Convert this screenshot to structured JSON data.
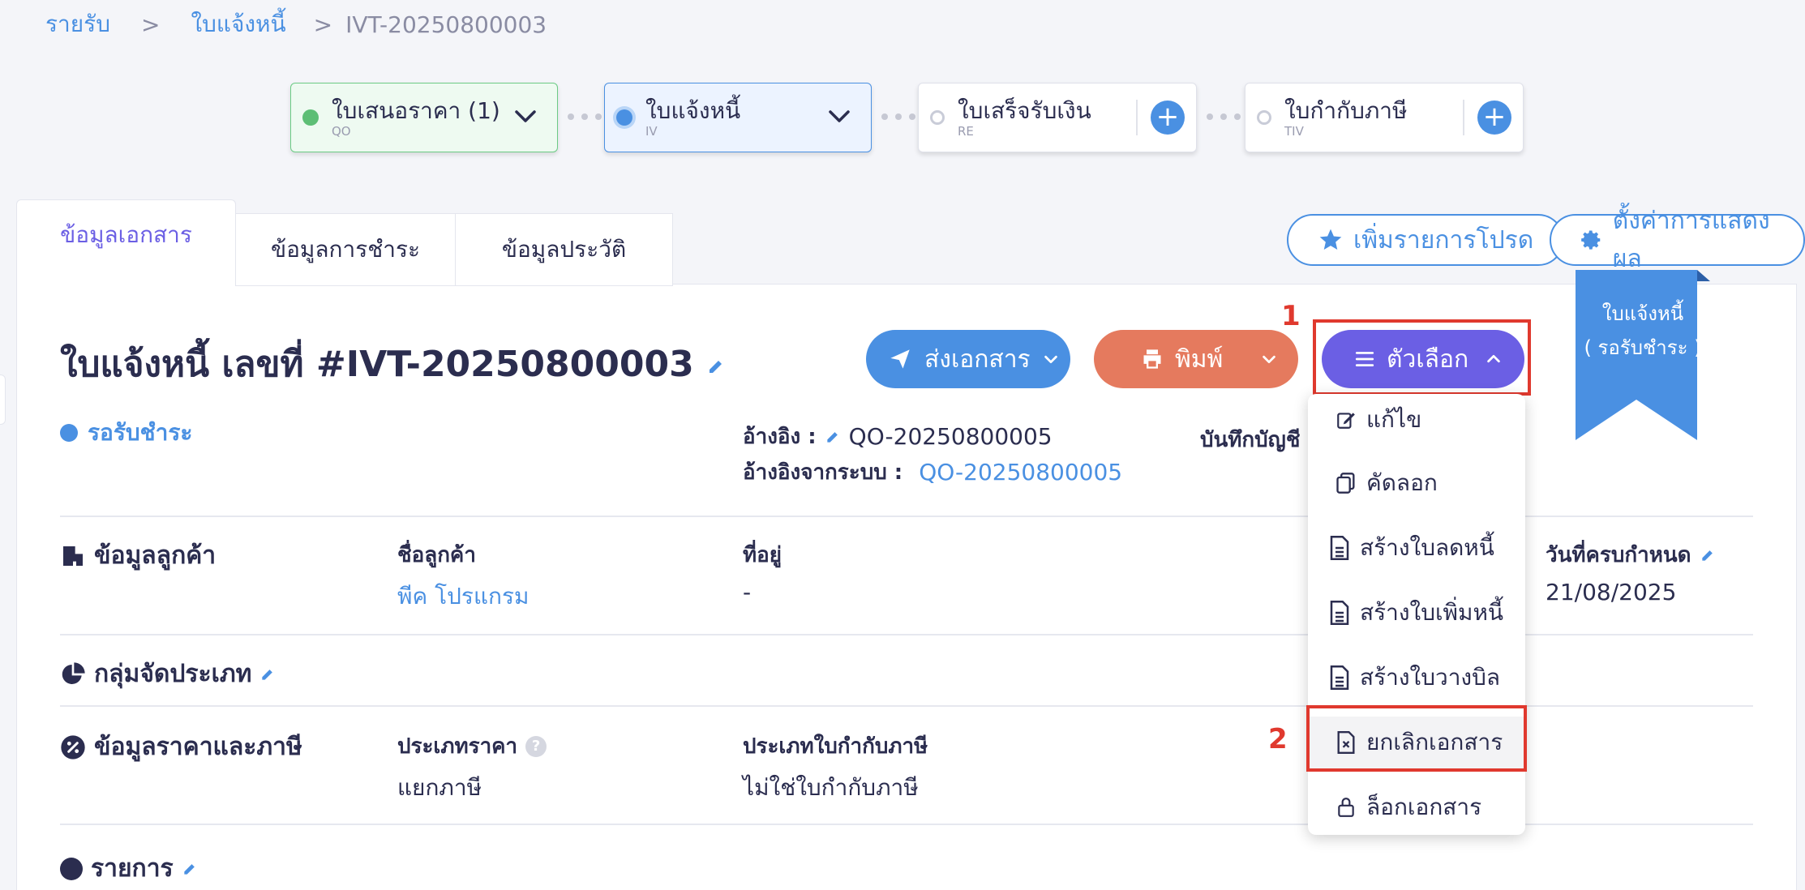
{
  "breadcrumb": {
    "items": [
      "รายรับ",
      "ใบแจ้งหนี้",
      "IVT-20250800003"
    ],
    "separator": ">"
  },
  "stepper": [
    {
      "label": "ใบเสนอราคา (1)",
      "code": "QO",
      "state": "done"
    },
    {
      "label": "ใบแจ้งหนี้",
      "code": "IV",
      "state": "active"
    },
    {
      "label": "ใบเสร็จรับเงิน",
      "code": "RE",
      "state": "empty"
    },
    {
      "label": "ใบกำกับภาษี",
      "code": "TIV",
      "state": "empty"
    }
  ],
  "tabs": [
    "ข้อมูลเอกสาร",
    "ข้อมูลการชำระ",
    "ข้อมูลประวัติ"
  ],
  "actions": {
    "favorite": "เพิ่มรายการโปรด",
    "display_settings": "ตั้งค่าการแสดงผล"
  },
  "ribbon": {
    "line1": "ใบแจ้งหนี้",
    "line2": "( รอรับชำระ )"
  },
  "document": {
    "title": "ใบแจ้งหนี้ เลขที่ #IVT-20250800003",
    "status": "รอรับชำระ",
    "reference_label": "อ้างอิง :",
    "reference_value": "QO-20250800005",
    "system_reference_label": "อ้างอิงจากระบบ :",
    "system_reference_value": "QO-20250800005",
    "accounting_label": "บันทึกบัญชี :"
  },
  "buttons": {
    "send": "ส่งเอกสาร",
    "print": "พิมพ์",
    "options": "ตัวเลือก"
  },
  "markers": {
    "step1": "1",
    "step2": "2"
  },
  "menu": [
    {
      "label": "แก้ไข",
      "icon": "edit-icon"
    },
    {
      "label": "คัดลอก",
      "icon": "copy-icon"
    },
    {
      "label": "สร้างใบลดหนี้",
      "icon": "document-icon"
    },
    {
      "label": "สร้างใบเพิ่มหนี้",
      "icon": "document-icon"
    },
    {
      "label": "สร้างใบวางบิล",
      "icon": "document-icon"
    },
    {
      "label": "ยกเลิกเอกสาร",
      "icon": "cancel-document-icon"
    },
    {
      "label": "ล็อกเอกสาร",
      "icon": "lock-icon"
    }
  ],
  "customer": {
    "section": "ข้อมูลลูกค้า",
    "name_label": "ชื่อลูกค้า",
    "name_value": "พีค โปรแกรม",
    "address_label": "ที่อยู่",
    "address_value": "-",
    "due_label": "วันที่ครบกำหนด",
    "due_value": "21/08/2025"
  },
  "category": {
    "section": "กลุ่มจัดประเภท"
  },
  "pricing": {
    "section": "ข้อมูลราคาและภาษี",
    "price_type_label": "ประเภทราคา",
    "price_type_value": "แยกภาษี",
    "tax_invoice_label": "ประเภทใบกำกับภาษี",
    "tax_invoice_value": "ไม่ใช่ใบกำกับภาษี"
  },
  "items": {
    "section": "รายการ"
  },
  "colors": {
    "primary": "#4a90e2",
    "purple": "#6b5fe4",
    "print": "#e57a5e",
    "highlight": "#e0392e"
  }
}
